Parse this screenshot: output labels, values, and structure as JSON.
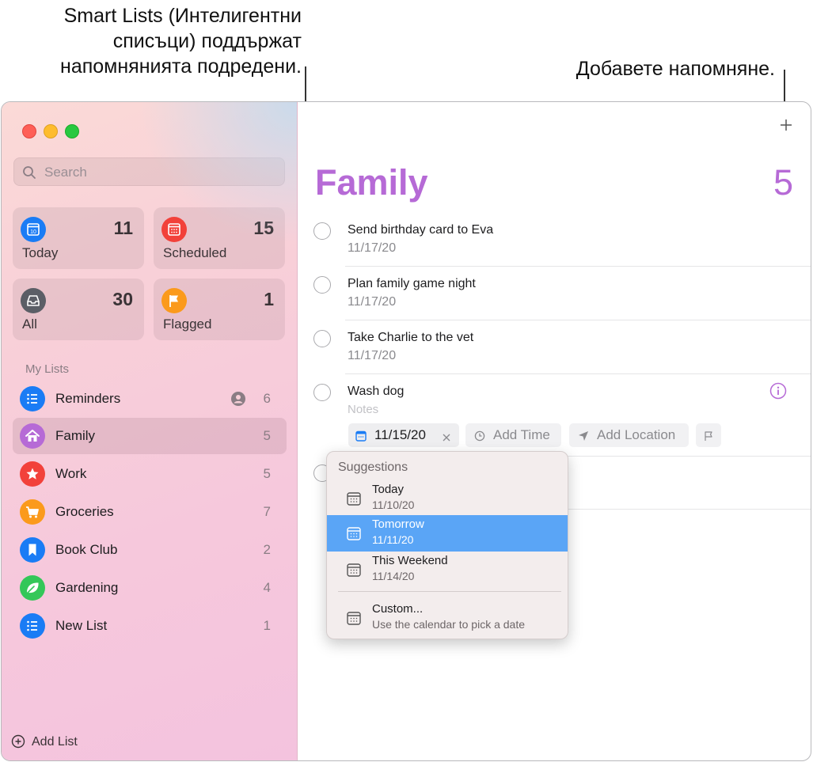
{
  "callouts": {
    "smart_lists": [
      "Smart Lists (Интелигентни",
      "списъци) поддържат",
      "напомнянията подредени."
    ],
    "add_reminder": "Добавете напомняне."
  },
  "sidebar": {
    "search_placeholder": "Search",
    "smart_lists": [
      {
        "label": "Today",
        "count": "11",
        "color": "#1a7cf5",
        "icon": "calendar-day-icon",
        "day": "10"
      },
      {
        "label": "Scheduled",
        "count": "15",
        "color": "#f2413a",
        "icon": "calendar-icon"
      },
      {
        "label": "All",
        "count": "30",
        "color": "#5b5e66",
        "icon": "tray-icon"
      },
      {
        "label": "Flagged",
        "count": "1",
        "color": "#fb9a1c",
        "icon": "flag-icon"
      }
    ],
    "section_title": "My Lists",
    "lists": [
      {
        "label": "Reminders",
        "count": "6",
        "color": "#1a7cf5",
        "icon": "list-bullet-icon",
        "shared": true
      },
      {
        "label": "Family",
        "count": "5",
        "color": "#b66ad6",
        "icon": "house-icon",
        "selected": true
      },
      {
        "label": "Work",
        "count": "5",
        "color": "#f2413a",
        "icon": "star-icon"
      },
      {
        "label": "Groceries",
        "count": "7",
        "color": "#fb9a1c",
        "icon": "cart-icon"
      },
      {
        "label": "Book Club",
        "count": "2",
        "color": "#1a7cf5",
        "icon": "bookmark-icon"
      },
      {
        "label": "Gardening",
        "count": "4",
        "color": "#34c759",
        "icon": "leaf-icon"
      },
      {
        "label": "New List",
        "count": "1",
        "color": "#1a7cf5",
        "icon": "list-bullet-icon"
      }
    ],
    "add_list": "Add List"
  },
  "main": {
    "title": "Family",
    "count": "5",
    "accent": "#b66ad6",
    "reminders": [
      {
        "title": "Send birthday card to Eva",
        "date": "11/17/20"
      },
      {
        "title": "Plan family game night",
        "date": "11/17/20"
      },
      {
        "title": "Take Charlie to the vet",
        "date": "11/17/20"
      }
    ],
    "editing": {
      "title": "Wash dog",
      "notes_placeholder": "Notes",
      "date_chip": "11/15/20",
      "add_time": "Add Time",
      "add_location": "Add Location"
    }
  },
  "suggestions": {
    "title": "Suggestions",
    "items": [
      {
        "name": "Today",
        "date": "11/10/20"
      },
      {
        "name": "Tomorrow",
        "date": "11/11/20",
        "highlighted": true
      },
      {
        "name": "This Weekend",
        "date": "11/14/20"
      }
    ],
    "custom": {
      "name": "Custom...",
      "desc": "Use the calendar to pick a date"
    }
  }
}
